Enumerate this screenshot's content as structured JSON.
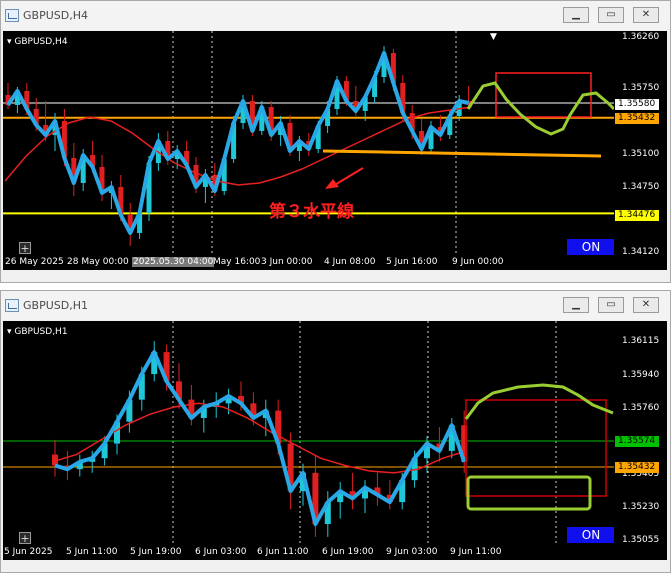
{
  "windows": [
    {
      "title": "GBPUSD,H4",
      "symbol_label": "GBPUSD,H4",
      "y_ticks": [
        "1.36260",
        "1.35750",
        "1.35100",
        "1.34750",
        "1.34120"
      ],
      "price_tags": [
        {
          "text": "1.35580",
          "bg": "#ffffff"
        },
        {
          "text": "1.35432",
          "bg": "#ffa500"
        },
        {
          "text": "1.34476",
          "bg": "#ffff00"
        }
      ],
      "x_ticks": [
        "26 May 2025",
        "28 May 00:00",
        "2025.05.30 04:00",
        "May 16:00",
        "3 Jun 00:00",
        "4 Jun 08:00",
        "5 Jun 16:00",
        "9 Jun 00:00"
      ],
      "annotation": "第３水平線",
      "on_label": "ON"
    },
    {
      "title": "GBPUSD,H1",
      "symbol_label": "GBPUSD,H1",
      "y_ticks": [
        "1.36115",
        "1.35940",
        "1.35760",
        "1.35405",
        "1.35230",
        "1.35055"
      ],
      "price_tags": [
        {
          "text": "1.35574",
          "bg": "#00c000"
        },
        {
          "text": "1.35432",
          "bg": "#ffa500"
        }
      ],
      "x_ticks": [
        "5 Jun 2025",
        "5 Jun 11:00",
        "5 Jun 19:00",
        "6 Jun 03:00",
        "6 Jun 11:00",
        "6 Jun 19:00",
        "9 Jun 03:00",
        "9 Jun 11:00"
      ],
      "on_label": "ON"
    }
  ],
  "chart_data": [
    {
      "type": "candlestick",
      "title": "GBPUSD,H4",
      "ylim": [
        1.3405,
        1.363
      ],
      "horizontal_lines": [
        1.3558,
        1.35432,
        1.34476
      ],
      "candles": [
        [
          1.3566,
          1.3578,
          1.3552,
          1.3556
        ],
        [
          1.3556,
          1.3574,
          1.3548,
          1.357
        ],
        [
          1.357,
          1.3578,
          1.3546,
          1.3552
        ],
        [
          1.3552,
          1.3563,
          1.353,
          1.3536
        ],
        [
          1.3536,
          1.356,
          1.352,
          1.3526
        ],
        [
          1.3526,
          1.3548,
          1.351,
          1.354
        ],
        [
          1.354,
          1.3552,
          1.3495,
          1.3503
        ],
        [
          1.3503,
          1.3518,
          1.3465,
          1.3478
        ],
        [
          1.3478,
          1.3512,
          1.347,
          1.3506
        ],
        [
          1.3506,
          1.352,
          1.3488,
          1.3494
        ],
        [
          1.3494,
          1.3506,
          1.346,
          1.3468
        ],
        [
          1.3468,
          1.348,
          1.3452,
          1.3474
        ],
        [
          1.3474,
          1.3486,
          1.344,
          1.3446
        ],
        [
          1.3446,
          1.3458,
          1.3415,
          1.3428
        ],
        [
          1.3428,
          1.3455,
          1.3422,
          1.3448
        ],
        [
          1.3448,
          1.3505,
          1.344,
          1.3498
        ],
        [
          1.3498,
          1.3528,
          1.349,
          1.352
        ],
        [
          1.352,
          1.353,
          1.3496,
          1.3502
        ],
        [
          1.3502,
          1.3516,
          1.3492,
          1.351
        ],
        [
          1.351,
          1.352,
          1.3492,
          1.3496
        ],
        [
          1.3496,
          1.3504,
          1.3468,
          1.3474
        ],
        [
          1.3474,
          1.3492,
          1.3458,
          1.3486
        ],
        [
          1.3486,
          1.3498,
          1.3465,
          1.347
        ],
        [
          1.347,
          1.3505,
          1.3466,
          1.3502
        ],
        [
          1.3502,
          1.3545,
          1.3498,
          1.3538
        ],
        [
          1.3538,
          1.3566,
          1.3532,
          1.356
        ],
        [
          1.356,
          1.3566,
          1.3525,
          1.353
        ],
        [
          1.353,
          1.356,
          1.3526,
          1.3554
        ],
        [
          1.3554,
          1.356,
          1.352,
          1.3526
        ],
        [
          1.3526,
          1.3545,
          1.3515,
          1.3538
        ],
        [
          1.3538,
          1.3546,
          1.3505,
          1.351
        ],
        [
          1.351,
          1.3525,
          1.35,
          1.352
        ],
        [
          1.352,
          1.3528,
          1.3505,
          1.3512
        ],
        [
          1.3512,
          1.354,
          1.3508,
          1.3535
        ],
        [
          1.3535,
          1.356,
          1.3528,
          1.3552
        ],
        [
          1.3552,
          1.3585,
          1.3546,
          1.358
        ],
        [
          1.358,
          1.3585,
          1.3555,
          1.356
        ],
        [
          1.356,
          1.3575,
          1.3545,
          1.355
        ],
        [
          1.355,
          1.3568,
          1.354,
          1.3564
        ],
        [
          1.3564,
          1.359,
          1.3558,
          1.3584
        ],
        [
          1.3584,
          1.3615,
          1.3578,
          1.3608
        ],
        [
          1.3608,
          1.3612,
          1.357,
          1.3578
        ],
        [
          1.3578,
          1.3586,
          1.354,
          1.3548
        ],
        [
          1.3548,
          1.3556,
          1.3522,
          1.353
        ],
        [
          1.353,
          1.3542,
          1.3506,
          1.3512
        ],
        [
          1.3512,
          1.354,
          1.3508,
          1.3534
        ],
        [
          1.3534,
          1.3546,
          1.352,
          1.3526
        ],
        [
          1.3526,
          1.355,
          1.3522,
          1.3545
        ],
        [
          1.3545,
          1.3566,
          1.354,
          1.356
        ],
        [
          1.356,
          1.3575,
          1.3552,
          1.3558
        ]
      ],
      "moving_average": [
        1.348,
        1.3505,
        1.3525,
        1.3538,
        1.3544,
        1.354,
        1.3528,
        1.3512,
        1.3498,
        1.3488,
        1.348,
        1.3476,
        1.3478,
        1.3484,
        1.3492,
        1.3502,
        1.3512,
        1.3522,
        1.3532,
        1.3542,
        1.3548,
        1.3551,
        1.3554
      ],
      "annotations": [
        {
          "kind": "line",
          "color": "#ffa500",
          "points": [
            [
              1.351
            ],
            [
              1.3505
            ]
          ]
        },
        {
          "kind": "rectangle",
          "color": "#ff2020"
        },
        {
          "kind": "freehand",
          "color": "#99d040"
        },
        {
          "kind": "text",
          "text": "第３水平線",
          "color": "#ff2020"
        }
      ]
    },
    {
      "type": "candlestick",
      "title": "GBPUSD,H1",
      "ylim": [
        1.35,
        1.3623
      ],
      "horizontal_lines": [
        1.35574,
        1.35432
      ],
      "candles": [
        [
          1.355,
          1.3558,
          1.3538,
          1.3544
        ],
        [
          1.3544,
          1.3552,
          1.3536,
          1.3542
        ],
        [
          1.3542,
          1.355,
          1.3538,
          1.3546
        ],
        [
          1.3546,
          1.3552,
          1.354,
          1.3548
        ],
        [
          1.3548,
          1.356,
          1.3544,
          1.3556
        ],
        [
          1.3556,
          1.3572,
          1.355,
          1.3568
        ],
        [
          1.3568,
          1.3585,
          1.3562,
          1.358
        ],
        [
          1.358,
          1.3598,
          1.3574,
          1.3594
        ],
        [
          1.3594,
          1.3612,
          1.359,
          1.3606
        ],
        [
          1.3606,
          1.361,
          1.3585,
          1.359
        ],
        [
          1.359,
          1.36,
          1.3575,
          1.358
        ],
        [
          1.358,
          1.3588,
          1.3566,
          1.357
        ],
        [
          1.357,
          1.358,
          1.3562,
          1.3576
        ],
        [
          1.3576,
          1.3584,
          1.357,
          1.3578
        ],
        [
          1.3578,
          1.3586,
          1.3572,
          1.3582
        ],
        [
          1.3582,
          1.359,
          1.3574,
          1.3578
        ],
        [
          1.3578,
          1.3584,
          1.3566,
          1.357
        ],
        [
          1.357,
          1.358,
          1.356,
          1.3574
        ],
        [
          1.3574,
          1.358,
          1.355,
          1.3556
        ],
        [
          1.3556,
          1.3562,
          1.352,
          1.353
        ],
        [
          1.353,
          1.3545,
          1.3522,
          1.354
        ],
        [
          1.354,
          1.355,
          1.3505,
          1.3512
        ],
        [
          1.3512,
          1.353,
          1.3505,
          1.3524
        ],
        [
          1.3524,
          1.3535,
          1.3515,
          1.353
        ],
        [
          1.353,
          1.354,
          1.352,
          1.3526
        ],
        [
          1.3526,
          1.3536,
          1.3518,
          1.3532
        ],
        [
          1.3532,
          1.354,
          1.3522,
          1.3528
        ],
        [
          1.3528,
          1.3536,
          1.352,
          1.3524
        ],
        [
          1.3524,
          1.354,
          1.352,
          1.3536
        ],
        [
          1.3536,
          1.3552,
          1.3532,
          1.3548
        ],
        [
          1.3548,
          1.356,
          1.354,
          1.3556
        ],
        [
          1.3556,
          1.3565,
          1.3546,
          1.3552
        ],
        [
          1.3552,
          1.357,
          1.3548,
          1.3566
        ],
        [
          1.3566,
          1.3574,
          1.354,
          1.3546
        ]
      ],
      "moving_average": [
        1.3546,
        1.355,
        1.3558,
        1.3566,
        1.3572,
        1.3576,
        1.3578,
        1.3576,
        1.357,
        1.3562,
        1.3555,
        1.3548,
        1.3544,
        1.3541,
        1.354,
        1.3542,
        1.3548,
        1.3552
      ],
      "annotations": [
        {
          "kind": "rectangle",
          "color": "#ff2020"
        },
        {
          "kind": "rectangle",
          "color": "#99d040"
        },
        {
          "kind": "freehand",
          "color": "#99d040"
        }
      ]
    }
  ]
}
